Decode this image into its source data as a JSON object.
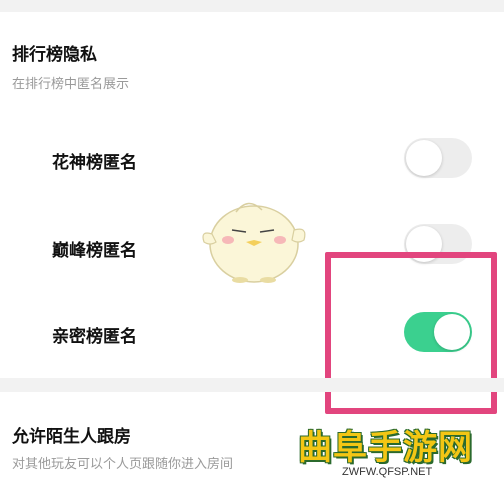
{
  "section_ranking": {
    "title": "排行榜隐私",
    "subtitle": "在排行榜中匿名展示",
    "rows": [
      {
        "label": "花神榜匿名",
        "enabled": false
      },
      {
        "label": "巅峰榜匿名",
        "enabled": false
      },
      {
        "label": "亲密榜匿名",
        "enabled": true
      }
    ]
  },
  "section_follow": {
    "title": "允许陌生人跟房",
    "subtitle": "对其他玩友可以个人页跟随你进入房间"
  },
  "watermark": {
    "main": "曲阜手游网",
    "url": "ZWFW.QFSP.NET"
  },
  "colors": {
    "toggle_on": "#3bd08f",
    "toggle_off": "#ededed",
    "highlight": "#e2457e"
  }
}
